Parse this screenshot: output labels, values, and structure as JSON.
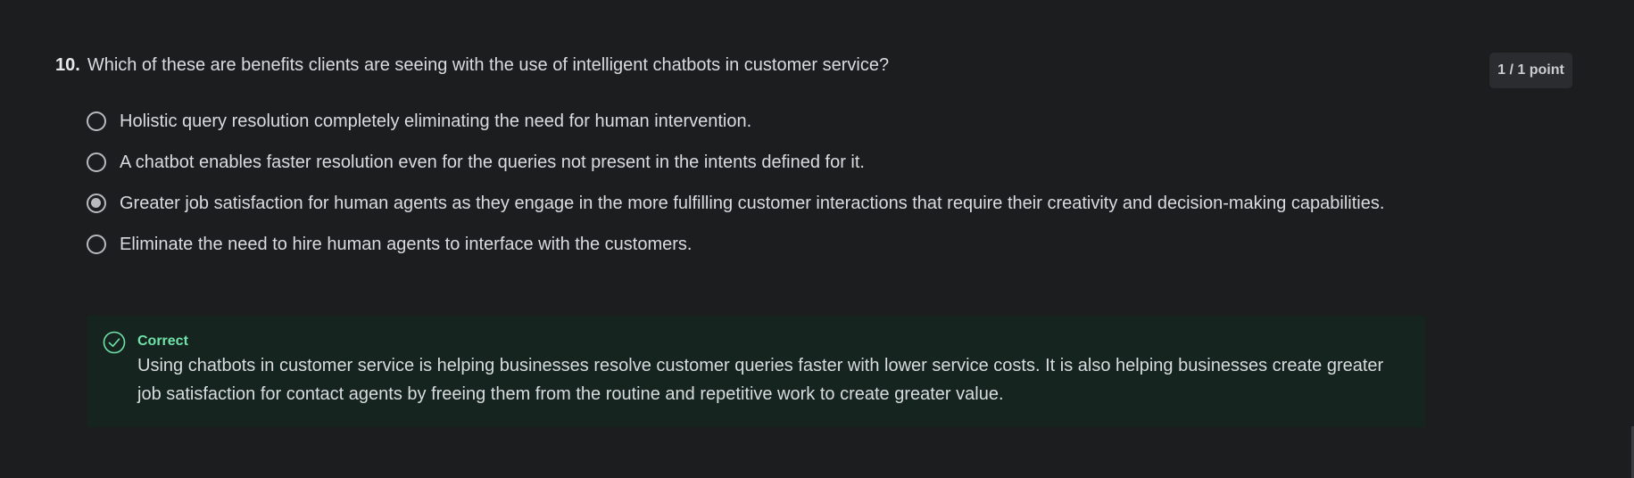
{
  "question": {
    "number": "10.",
    "text": "Which of these are benefits clients are seeing with the use of intelligent chatbots in customer service?",
    "points": "1 / 1 point"
  },
  "options": [
    {
      "label": "Holistic query resolution completely eliminating the need for human intervention.",
      "selected": false
    },
    {
      "label": "A chatbot enables faster resolution even for the queries not present in the intents defined for it.",
      "selected": false
    },
    {
      "label": "Greater job satisfaction for human agents as they engage in the more fulfilling customer interactions that require their creativity and decision-making capabilities.",
      "selected": true
    },
    {
      "label": "Eliminate the need to hire human agents to interface with the customers.",
      "selected": false
    }
  ],
  "feedback": {
    "status": "Correct",
    "text": "Using chatbots in customer service is helping businesses resolve customer queries faster with lower service costs. It is also helping businesses create greater job satisfaction for contact agents by freeing them from the routine and repetitive work to create greater value.",
    "icon": "check-circle-icon"
  },
  "colors": {
    "background": "#1c1d1f",
    "feedback_background": "#15241f",
    "correct_accent": "#6fe3a9",
    "radio": "#b7bbbf"
  }
}
